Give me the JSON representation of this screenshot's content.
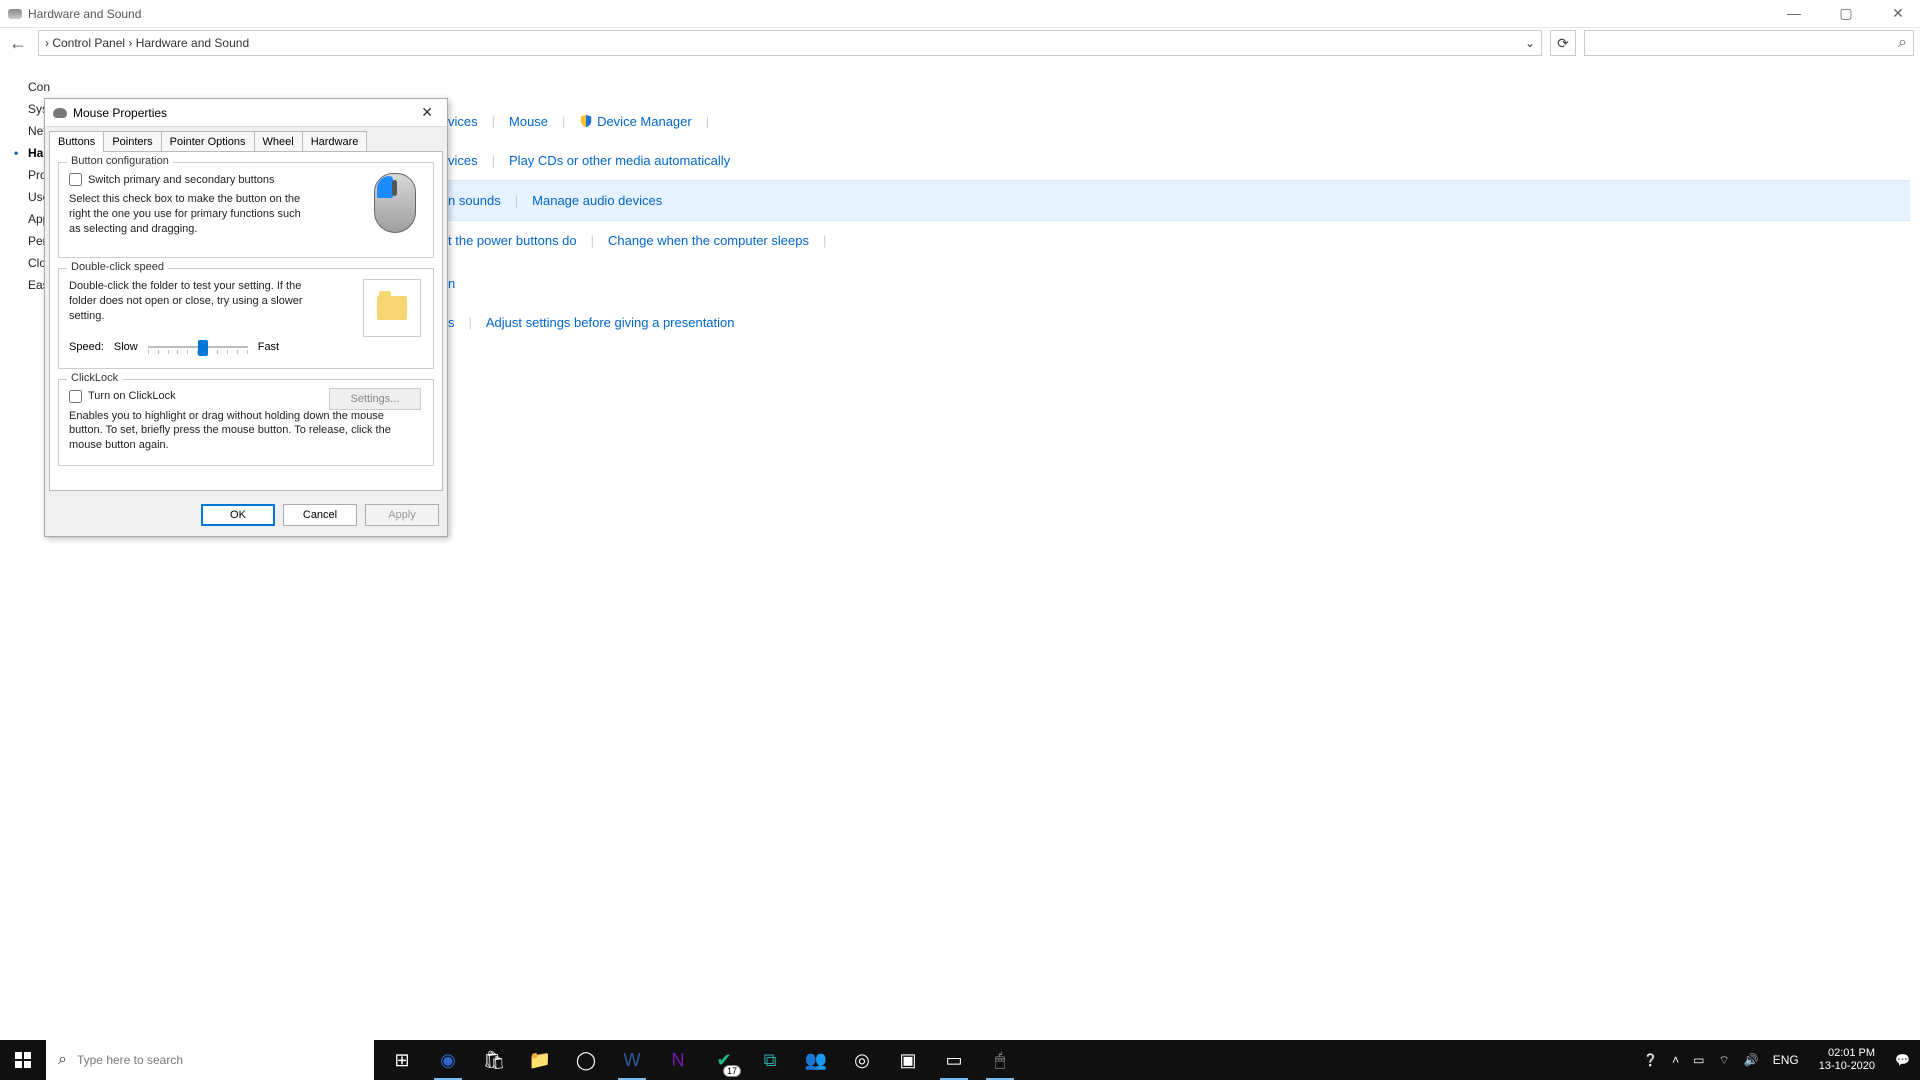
{
  "window": {
    "title": "Hardware and Sound"
  },
  "address": {
    "breadcrumb": "› Control Panel › Hardware and Sound",
    "dropdown": "⌄"
  },
  "sidebar": {
    "items": [
      "Con",
      "Syst",
      "Net",
      "Har",
      "Pro",
      "Use",
      "App",
      "Pers",
      "Clo",
      "Eas"
    ],
    "active_index": 3
  },
  "main": {
    "row1": {
      "partial": "vices",
      "mouse": "Mouse",
      "devmgr": "Device Manager"
    },
    "row2": {
      "partial": "vices",
      "play": "Play CDs or other media automatically"
    },
    "row3": {
      "partial": "n sounds",
      "manage": "Manage audio devices"
    },
    "row4": {
      "partial": "t the power buttons do",
      "sleep": "Change when the computer sleeps",
      "plan_partial": "n"
    },
    "row5": {
      "partial": "s",
      "adjust": "Adjust settings before giving a presentation"
    }
  },
  "dialog": {
    "title": "Mouse Properties",
    "tabs": [
      "Buttons",
      "Pointers",
      "Pointer Options",
      "Wheel",
      "Hardware"
    ],
    "active_tab": 0,
    "group1": {
      "title": "Button configuration",
      "checkbox": "Switch primary and secondary buttons",
      "desc": "Select this check box to make the button on the right the one you use for primary functions such as selecting and dragging."
    },
    "group2": {
      "title": "Double-click speed",
      "desc": "Double-click the folder to test your setting. If the folder does not open or close, try using a slower setting.",
      "speed_label": "Speed:",
      "slow": "Slow",
      "fast": "Fast",
      "thumb_percent": 55
    },
    "group3": {
      "title": "ClickLock",
      "checkbox": "Turn on ClickLock",
      "settings": "Settings...",
      "desc": "Enables you to highlight or drag without holding down the mouse button. To set, briefly press the mouse button. To release, click the mouse button again."
    },
    "buttons": {
      "ok": "OK",
      "cancel": "Cancel",
      "apply": "Apply"
    }
  },
  "taskbar": {
    "search_placeholder": "Type here to search",
    "lang": "ENG",
    "time": "02:01 PM",
    "date": "13-10-2020",
    "badge": "17"
  }
}
